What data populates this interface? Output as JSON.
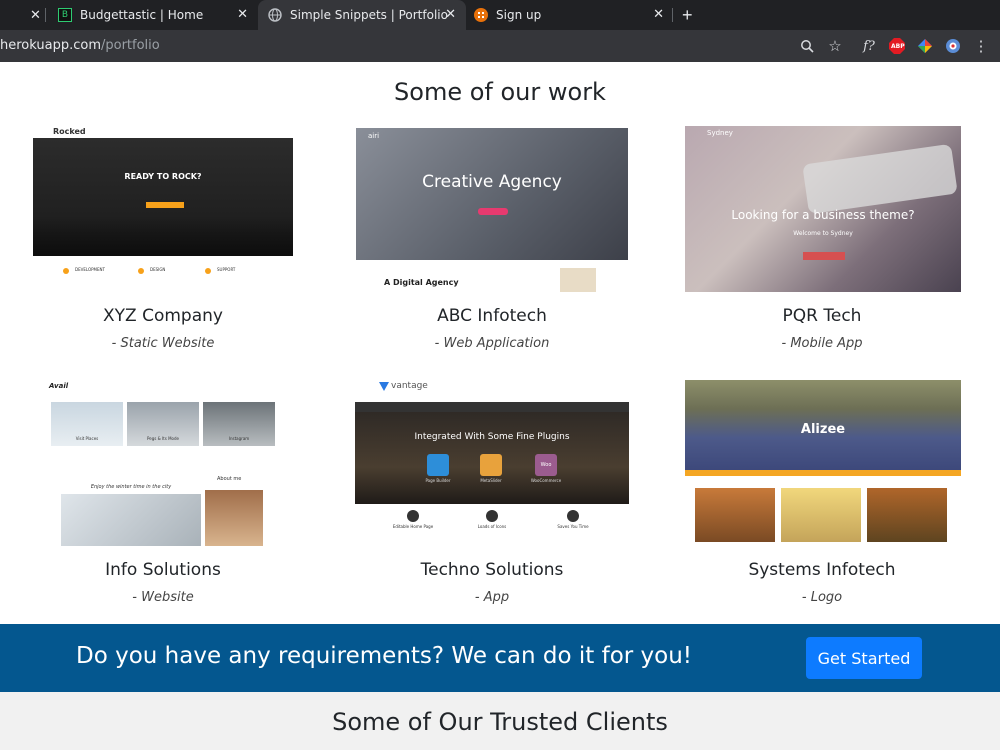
{
  "browser": {
    "tabs": [
      {
        "title": "Budgettastic | Home",
        "favicon": "B"
      },
      {
        "title": "Simple Snippets | Portfolio",
        "favicon": "globe-icon"
      },
      {
        "title": "Sign up",
        "favicon": "grid-icon"
      }
    ],
    "url_host": "herokuapp.com",
    "url_path": "/portfolio",
    "extensions": [
      "f?",
      "ABP"
    ]
  },
  "portfolio": {
    "title": "Some of our work",
    "items": [
      {
        "name": "XYZ Company",
        "type": "- Static Website",
        "thumb_heading": "READY TO ROCK?",
        "thumb_brand": "Rocked",
        "thumb_features": [
          "DEVELOPMENT",
          "DESIGN",
          "SUPPORT"
        ]
      },
      {
        "name": "ABC Infotech",
        "type": "- Web Application",
        "thumb_heading": "Creative Agency",
        "thumb_brand": "airi",
        "thumb_footer": "A Digital Agency"
      },
      {
        "name": "PQR Tech",
        "type": "- Mobile App",
        "thumb_heading": "Looking for a business theme?",
        "thumb_brand": "Sydney",
        "thumb_sub": "Welcome to Sydney"
      },
      {
        "name": "Info Solutions",
        "type": "- Website",
        "thumb_brand": "Avail",
        "thumb_heading": "Enjoy the winter time in the city",
        "thumb_captions": [
          "Visit Places",
          "Pegs & Its Mode",
          "Instagram"
        ],
        "thumb_aside": "About me"
      },
      {
        "name": "Techno Solutions",
        "type": "- App",
        "thumb_brand": "vantage",
        "thumb_heading": "Integrated With Some Fine Plugins",
        "thumb_plugins": [
          "Page Builder",
          "MetaSlider",
          "WooCommerce"
        ],
        "thumb_features": [
          "Editable Home Page",
          "Loads of Icons",
          "Saves You Time"
        ],
        "thumb_woo": "Woo"
      },
      {
        "name": "Systems Infotech",
        "type": "- Logo",
        "thumb_heading": "Alizee"
      }
    ]
  },
  "cta": {
    "text": "Do you have any requirements? We can do it for you!",
    "button": "Get Started"
  },
  "clients": {
    "title": "Some of Our Trusted Clients"
  },
  "colors": {
    "cta_bg": "#04578f",
    "button_bg": "#0d7bff",
    "chrome_dark": "#202124"
  }
}
